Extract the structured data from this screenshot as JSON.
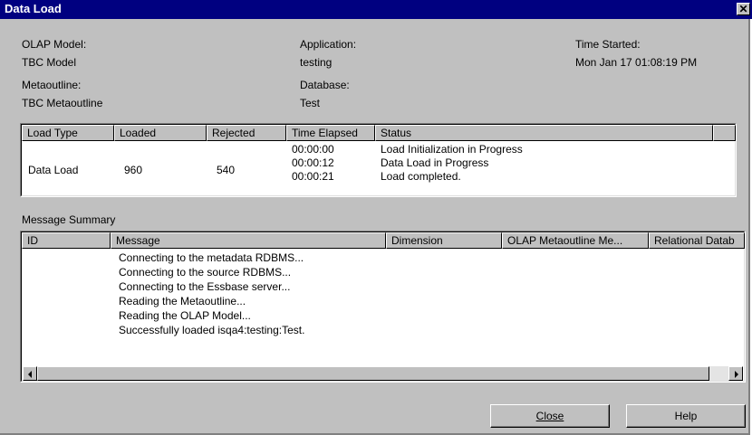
{
  "window": {
    "title": "Data Load"
  },
  "info": {
    "olap_model_label": "OLAP Model:",
    "olap_model_value": "TBC Model",
    "application_label": "Application:",
    "application_value": "testing",
    "time_started_label": "Time Started:",
    "time_started_value": "Mon Jan 17 01:08:19 PM",
    "metaoutline_label": "Metaoutline:",
    "metaoutline_value": "TBC Metaoutline",
    "database_label": "Database:",
    "database_value": "Test"
  },
  "load_table": {
    "columns": [
      "Load Type",
      "Loaded",
      "Rejected",
      "Time Elapsed",
      "Status"
    ],
    "row": {
      "load_type": "Data Load",
      "loaded": "960",
      "rejected": "540",
      "times": [
        "00:00:00",
        "00:00:12",
        "00:00:21"
      ],
      "statuses": [
        "Load Initialization in Progress",
        "Data  Load in Progress",
        "Load completed."
      ]
    }
  },
  "message_summary": {
    "label": "Message Summary",
    "columns": [
      "ID",
      "Message",
      "Dimension",
      "OLAP Metaoutline Me...",
      "Relational Datab"
    ],
    "messages": [
      "Connecting to the metadata RDBMS...",
      "Connecting to the source RDBMS...",
      "Connecting to the Essbase server...",
      "Reading the Metaoutline...",
      "Reading the OLAP Model...",
      "Successfully loaded isqa4:testing:Test."
    ]
  },
  "buttons": {
    "close_label": "Close",
    "help_label": "Help"
  },
  "icons": {
    "close": "close-x-icon",
    "scroll_left": "arrow-left-icon",
    "scroll_right": "arrow-right-icon"
  }
}
